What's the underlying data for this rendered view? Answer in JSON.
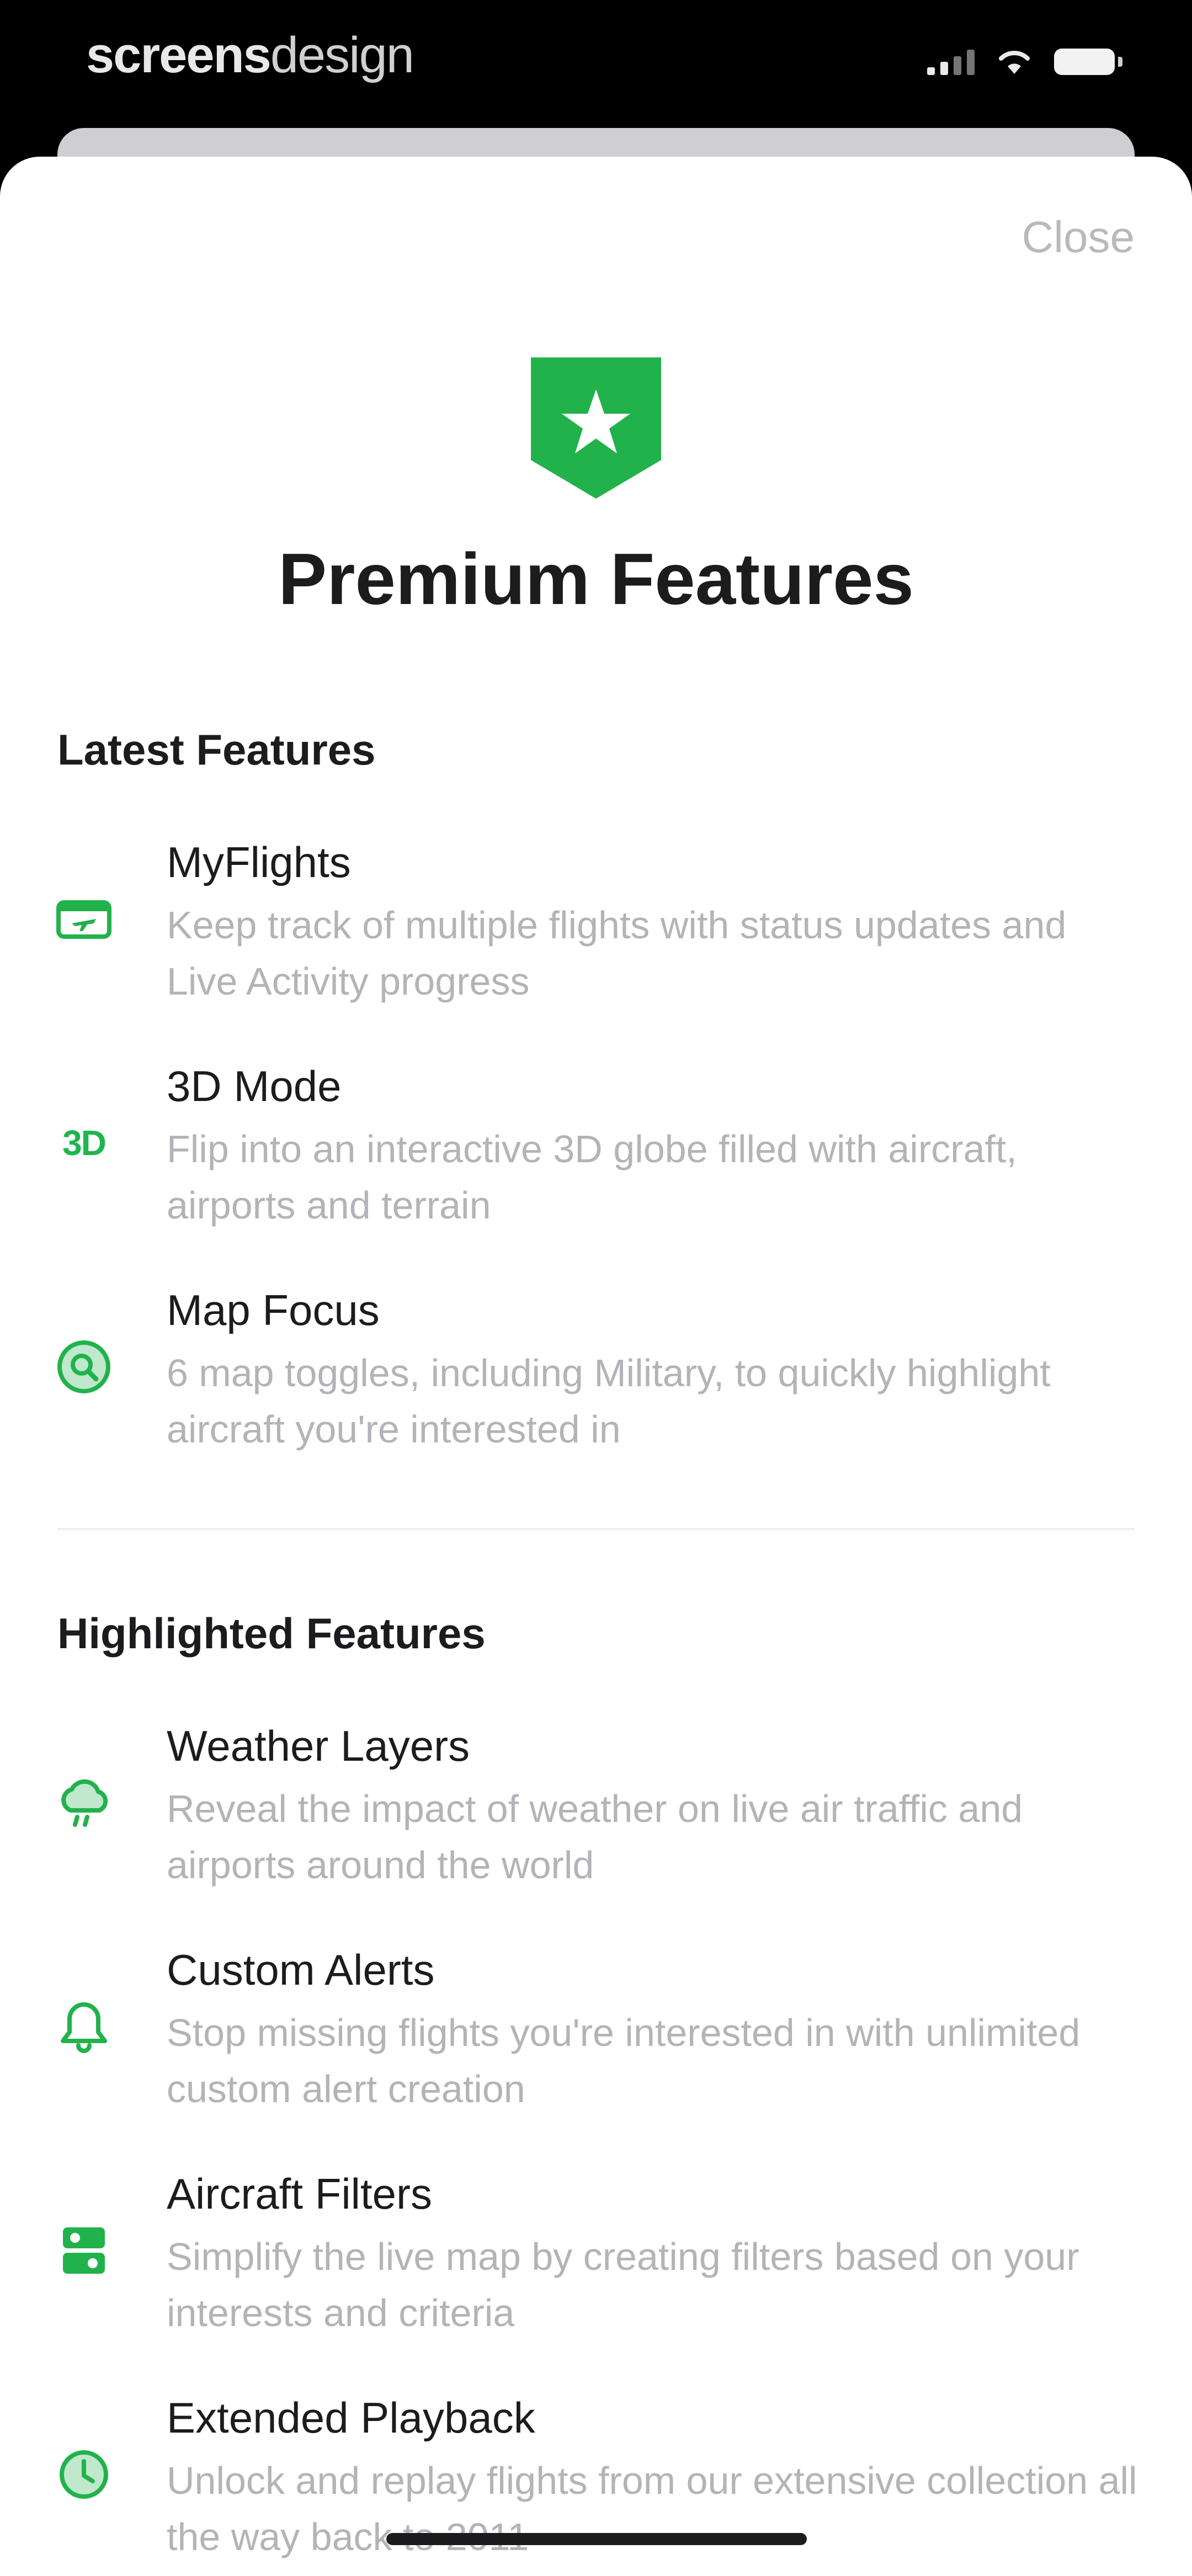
{
  "status_bar": {
    "brand_bold": "screens",
    "brand_light": "design"
  },
  "colors": {
    "accent": "#22b24c",
    "title": "#1c1c1e",
    "subtitle": "#b3b3b8",
    "close": "#b9b9bd"
  },
  "sheet": {
    "close_label": "Close",
    "title": "Premium Features"
  },
  "sections": [
    {
      "title": "Latest Features",
      "features": [
        {
          "name": "MyFlights",
          "description": "Keep track of multiple flights with status updates and Live Activity progress",
          "icon": "plane-ticket-icon"
        },
        {
          "name": "3D Mode",
          "description": "Flip into an interactive 3D globe filled with aircraft, airports and terrain",
          "icon": "3d-icon",
          "icon_text": "3D"
        },
        {
          "name": "Map Focus",
          "description": "6 map toggles, including Military, to quickly highlight aircraft you're interested in",
          "icon": "map-focus-icon"
        }
      ]
    },
    {
      "title": "Highlighted Features",
      "features": [
        {
          "name": "Weather Layers",
          "description": "Reveal the impact of weather on live air traffic and airports around the world",
          "icon": "weather-cloud-icon"
        },
        {
          "name": "Custom Alerts",
          "description": "Stop missing flights you're interested in with unlimited custom alert creation",
          "icon": "bell-icon"
        },
        {
          "name": "Aircraft Filters",
          "description": "Simplify the live map by creating filters based on your interests and criteria",
          "icon": "filter-icon"
        },
        {
          "name": "Extended Playback",
          "description": "Unlock and replay flights from our extensive collection all the way back to 2011",
          "icon": "playback-history-icon"
        }
      ]
    }
  ]
}
